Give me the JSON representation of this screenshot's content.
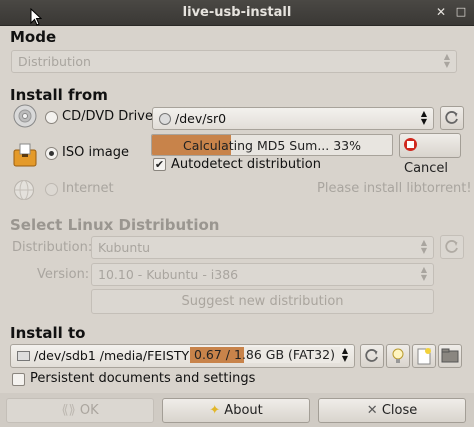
{
  "window": {
    "title": "live-usb-install"
  },
  "mode": {
    "heading": "Mode",
    "value": "Distribution"
  },
  "install_from": {
    "heading": "Install from",
    "cd_label": "CD/DVD Drive",
    "cd_device": "/dev/sr0",
    "iso_label": "ISO image",
    "progress_text": "Calculating MD5 Sum... 33%",
    "progress_fraction": 0.33,
    "cancel_label": "Cancel",
    "autodetect_label": "Autodetect distribution",
    "autodetect_checked": true,
    "internet_label": "Internet",
    "torrent_note": "Please install libtorrent!"
  },
  "select_distro": {
    "heading": "Select Linux Distribution",
    "distribution_label": "Distribution:",
    "distribution_value": "Kubuntu",
    "version_label": "Version:",
    "version_value": "10.10 - Kubuntu - i386",
    "suggest_label": "Suggest new distribution"
  },
  "install_to": {
    "heading": "Install to",
    "device": "/dev/sdb1 /media/FEISTY",
    "usage_text": "0.67 / 1.86 GB (FAT32)",
    "usage_fraction": 0.36,
    "persistent_label": "Persistent documents and settings"
  },
  "buttons": {
    "ok": "OK",
    "about": "About",
    "close": "Close"
  },
  "colors": {
    "progress": "#c8834a",
    "cancel_icon": "#d0281e",
    "about_icon": "#e2b72a",
    "close_icon": "#5a5a5a"
  }
}
